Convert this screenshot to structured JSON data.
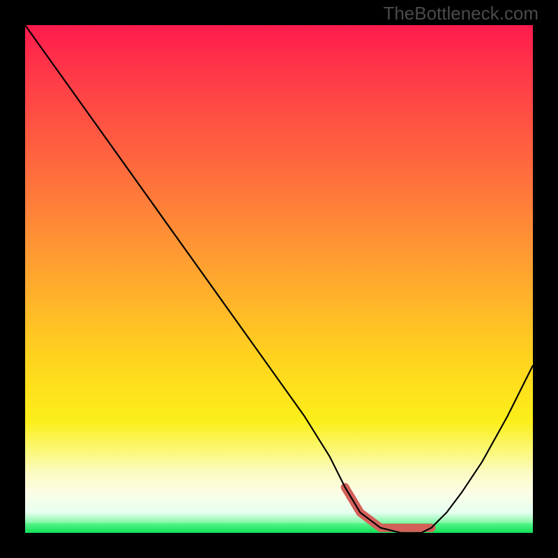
{
  "watermark": "TheBottleneck.com",
  "colors": {
    "page_bg": "#000000",
    "gradient_top": "#ff1a4d",
    "gradient_mid": "#ffd21f",
    "gradient_bottom": "#20f060",
    "curve": "#000000",
    "highlight": "#d4605a"
  },
  "chart_data": {
    "type": "line",
    "title": "",
    "xlabel": "",
    "ylabel": "",
    "xlim": [
      0,
      100
    ],
    "ylim": [
      0,
      100
    ],
    "grid": false,
    "series": [
      {
        "name": "bottleneck-curve",
        "x": [
          0,
          5,
          10,
          15,
          20,
          25,
          30,
          35,
          40,
          45,
          50,
          55,
          60,
          63,
          66,
          70,
          74,
          78,
          80,
          83,
          86,
          90,
          95,
          100
        ],
        "values": [
          100,
          93,
          86,
          79,
          72,
          65,
          58,
          51,
          44,
          37,
          30,
          23,
          15,
          9,
          4,
          1,
          0,
          0,
          1,
          4,
          8,
          14,
          23,
          33
        ]
      }
    ],
    "annotations": [
      {
        "name": "optimal-range-highlight",
        "x_start": 63,
        "x_end": 80,
        "y": 1
      }
    ]
  }
}
